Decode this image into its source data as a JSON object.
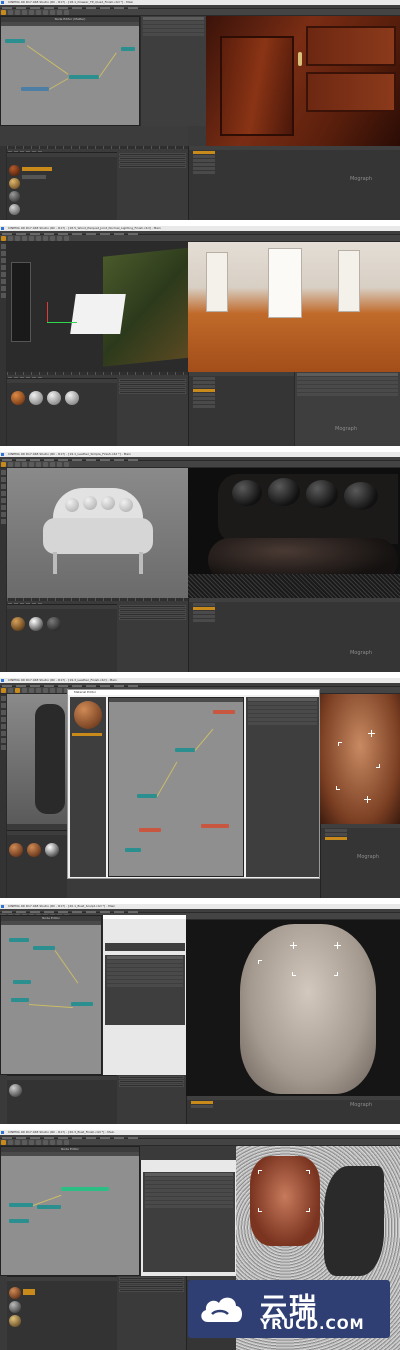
{
  "screens": [
    {
      "title": "CINEMA 4D R17.048 Studio (RC - R17) - [18.1_Drawer_TP_Quad_Finish.c4d *] - Main",
      "node_editor_title": "Node Editor (Matter)",
      "brand": "Mograph"
    },
    {
      "title": "CINEMA 4D R17.048 Studio (RC - R17) - [18.5_Wood_Parquet_Joint_Normal_Lighting_Finish.c4d] - Main",
      "brand": "Mograph"
    },
    {
      "title": "CINEMA 4D R17.048 Studio (RC - R17) - [19.1_Leather_Simple_Finish.c4d *] - Main",
      "brand": "Mograph"
    },
    {
      "title": "CINEMA 4D R17.048 Studio (RC - R17) - [19.3_Leather_Finish.c4d] - Main",
      "node_editor_title": "Material Editor",
      "brand": "Mograph"
    },
    {
      "title": "CINEMA 4D R17.048 Studio (RC - R17) - [20.1_Bust_Sculpt.c4d *] - Main",
      "node_editor_title": "Node Editor",
      "brand": "Mograph"
    },
    {
      "title": "CINEMA 4D R17.048 Studio (RC - R17) - [20.3_Bust_Finish.c4d *] - Main",
      "node_editor_title": "Node Editor",
      "brand": "Mograph"
    }
  ],
  "watermark": {
    "cn": "云瑞",
    "en": "YRUCD.COM",
    "bg": "#2f3f74"
  },
  "colors": {
    "ui_dark": "#3a3a3a",
    "accent_orange": "#c98a1c",
    "node_green": "#2bbf86",
    "node_teal": "#2b8f8f"
  }
}
